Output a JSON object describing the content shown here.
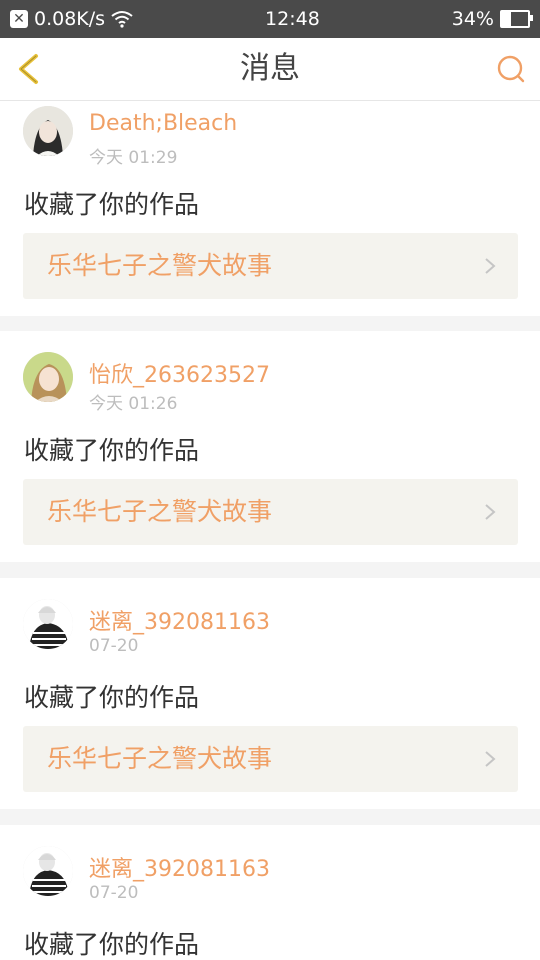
{
  "statusbar": {
    "net_speed": "0.08K/s",
    "time": "12:48",
    "battery": "34%",
    "battery_level": 0.34
  },
  "header": {
    "title": "消息"
  },
  "messages": [
    {
      "user": "Death;Bleach",
      "time": "今天 01:29",
      "action": "收藏了你的作品",
      "work_title": "乐华七子之警犬故事"
    },
    {
      "user": "怡欣_263623527",
      "time": "今天 01:26",
      "action": "收藏了你的作品",
      "work_title": "乐华七子之警犬故事"
    },
    {
      "user": "迷离_392081163",
      "time": "07-20",
      "action": "收藏了你的作品",
      "work_title": "乐华七子之警犬故事"
    },
    {
      "user": "迷离_392081163",
      "time": "07-20",
      "action": "收藏了你的作品"
    }
  ],
  "colors": {
    "accent": "#f0a066",
    "back_icon": "#e8c23a"
  }
}
